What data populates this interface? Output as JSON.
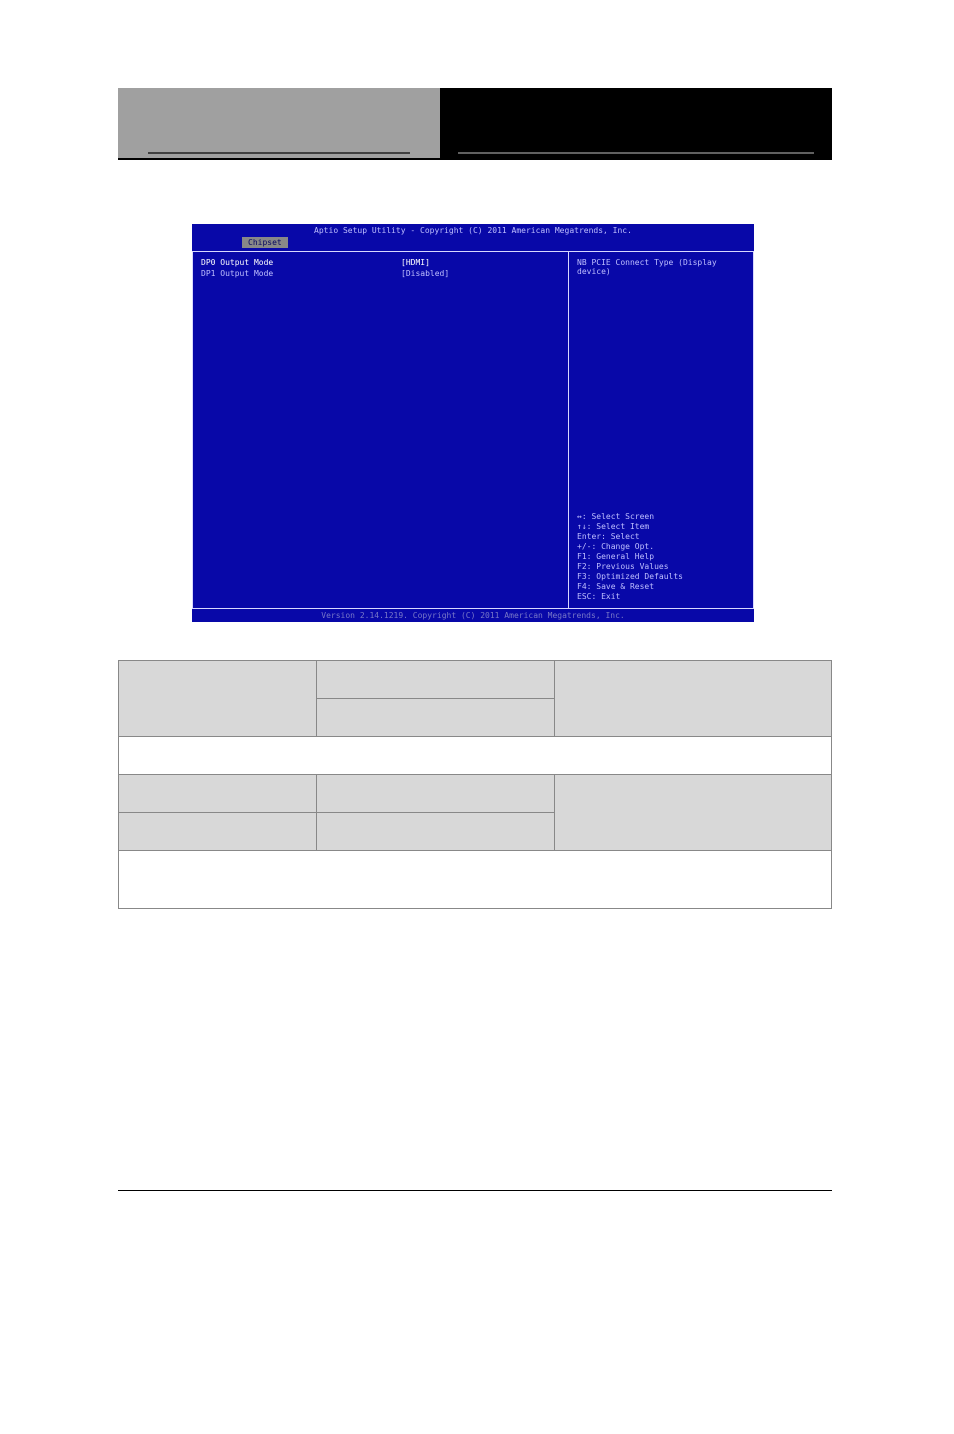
{
  "header": {
    "gray_text": "",
    "black_text": ""
  },
  "bios": {
    "title": "Aptio Setup Utility - Copyright (C) 2011 American Megatrends, Inc.",
    "tab": "Chipset",
    "rows": [
      {
        "label": "DP0 Output Mode",
        "value": "[HDMI]",
        "selected": true
      },
      {
        "label": "DP1 Output Mode",
        "value": "[Disabled]",
        "selected": false
      }
    ],
    "help_top": "NB PCIE Connect Type (Display device)",
    "help_bottom": [
      "↔: Select Screen",
      "↑↓: Select Item",
      "Enter: Select",
      "+/-: Change Opt.",
      "F1: General Help",
      "F2: Previous Values",
      "F3: Optimized Defaults",
      "F4: Save & Reset",
      "ESC: Exit"
    ],
    "footer": "Version 2.14.1219. Copyright (C) 2011 American Megatrends, Inc."
  },
  "table": {
    "r1c1": "",
    "r1c2a": "",
    "r1c2b": "",
    "r1c3": "",
    "r2": "",
    "r3c1": "",
    "r3c2": "",
    "r3c3": "",
    "r4c1": "",
    "r4c2": "",
    "r5": ""
  }
}
